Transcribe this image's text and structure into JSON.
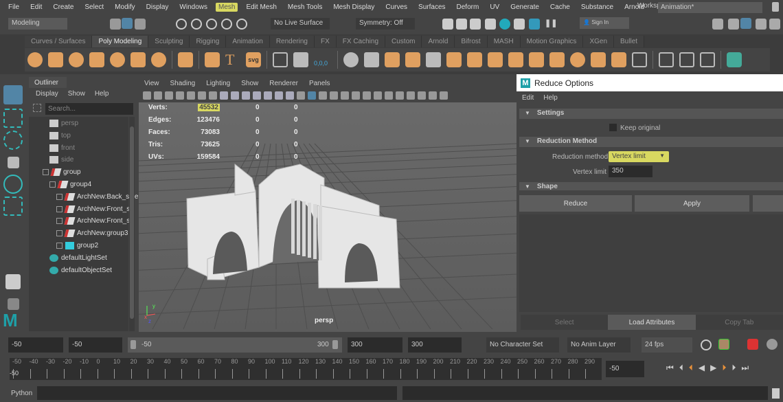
{
  "menubar": {
    "items": [
      "File",
      "Edit",
      "Create",
      "Select",
      "Modify",
      "Display",
      "Windows",
      "Mesh",
      "Edit Mesh",
      "Mesh Tools",
      "Mesh Display",
      "Curves",
      "Surfaces",
      "Deform",
      "UV",
      "Generate",
      "Cache",
      "Substance",
      "Arnold"
    ],
    "highlighted": "Mesh",
    "workspace_label": "Workspace :",
    "workspace_value": "Animation*"
  },
  "status": {
    "mode": "Modeling",
    "live_surface": "No Live Surface",
    "symmetry": "Symmetry: Off",
    "sign_in": "Sign In"
  },
  "shelf": {
    "tabs": [
      "Curves / Surfaces",
      "Poly Modeling",
      "Sculpting",
      "Rigging",
      "Animation",
      "Rendering",
      "FX",
      "FX Caching",
      "Custom",
      "Arnold",
      "Bifrost",
      "MASH",
      "Motion Graphics",
      "XGen",
      "Bullet"
    ],
    "active": "Poly Modeling",
    "svg_label": "svg",
    "text_label": "T",
    "snap_label": "0,0,0"
  },
  "outliner": {
    "tab": "Outliner",
    "menu": [
      "Display",
      "Show",
      "Help"
    ],
    "search_placeholder": "Search...",
    "items": [
      {
        "label": "persp",
        "type": "camera"
      },
      {
        "label": "top",
        "type": "camera"
      },
      {
        "label": "front",
        "type": "camera"
      },
      {
        "label": "side",
        "type": "camera"
      },
      {
        "label": "group",
        "type": "group"
      },
      {
        "label": "group4",
        "type": "group"
      },
      {
        "label": "ArchNew:Back_side",
        "type": "group"
      },
      {
        "label": "ArchNew:Front_s",
        "type": "group"
      },
      {
        "label": "ArchNew:Front_s",
        "type": "group"
      },
      {
        "label": "ArchNew:group3",
        "type": "group"
      },
      {
        "label": "group2",
        "type": "light"
      },
      {
        "label": "defaultLightSet",
        "type": "set"
      },
      {
        "label": "defaultObjectSet",
        "type": "set"
      }
    ]
  },
  "viewport": {
    "menu": [
      "View",
      "Shading",
      "Lighting",
      "Show",
      "Renderer",
      "Panels"
    ],
    "camera": "persp",
    "hud": [
      {
        "label": "Verts:",
        "value": "45532",
        "a": "0",
        "b": "0"
      },
      {
        "label": "Edges:",
        "value": "123476",
        "a": "0",
        "b": "0"
      },
      {
        "label": "Faces:",
        "value": "73083",
        "a": "0",
        "b": "0"
      },
      {
        "label": "Tris:",
        "value": "73625",
        "a": "0",
        "b": "0"
      },
      {
        "label": "UVs:",
        "value": "159584",
        "a": "0",
        "b": "0"
      }
    ],
    "axis": {
      "x": "x",
      "y": "y",
      "z": "z"
    }
  },
  "reduce": {
    "title": "Reduce Options",
    "menu": [
      "Edit",
      "Help"
    ],
    "settings": "Settings",
    "keep_original": "Keep original",
    "keep_original_checked": false,
    "reduction_section": "Reduction Method",
    "method_label": "Reduction method",
    "method_value": "Vertex limit",
    "vertex_limit_label": "Vertex limit",
    "vertex_limit_value": "350",
    "shape_section": "Shape",
    "buttons": [
      "Reduce",
      "Apply"
    ]
  },
  "attr_tabs": {
    "items": [
      "Select",
      "Load Attributes",
      "Copy Tab"
    ],
    "active": "Load Attributes"
  },
  "time": {
    "start": "-50",
    "anim_start": "-50",
    "range_start": "-50",
    "range_end": "300",
    "anim_end": "300",
    "end": "300",
    "character_set": "No Character Set",
    "anim_layer": "No Anim Layer",
    "fps": "24 fps",
    "current": "-50",
    "current_marker": "-50",
    "ticks": [
      "-50",
      "-40",
      "-30",
      "-20",
      "-10",
      "0",
      "10",
      "20",
      "30",
      "40",
      "50",
      "60",
      "70",
      "80",
      "90",
      "100",
      "110",
      "120",
      "130",
      "140",
      "150",
      "160",
      "170",
      "180",
      "190",
      "200",
      "210",
      "220",
      "230",
      "240",
      "250",
      "260",
      "270",
      "280",
      "290"
    ]
  },
  "cmdline": {
    "language": "Python"
  },
  "colors": {
    "accent": "#5285a6",
    "shelf_icon": "#e0a060",
    "highlight": "#d8d860"
  }
}
